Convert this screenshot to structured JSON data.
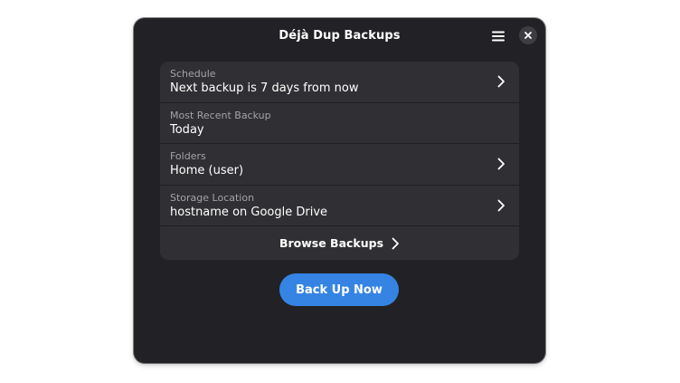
{
  "window": {
    "title": "Déjà Dup Backups",
    "icons": {
      "menu": "hamburger-menu-icon",
      "close": "close-icon",
      "chevron": "chevron-right-icon"
    }
  },
  "rows": [
    {
      "label": "Schedule",
      "value": "Next backup is 7 days from now",
      "has_chevron": true
    },
    {
      "label": "Most Recent Backup",
      "value": "Today",
      "has_chevron": false
    },
    {
      "label": "Folders",
      "value": "Home (user)",
      "has_chevron": true
    },
    {
      "label": "Storage Location",
      "value": "hostname on Google Drive",
      "has_chevron": true
    }
  ],
  "browse": {
    "label": "Browse Backups"
  },
  "primary_button": {
    "label": "Back Up Now"
  },
  "colors": {
    "window_bg": "#222226",
    "card_bg": "#303034",
    "accent": "#3584e4",
    "secondary_text": "#a4a4a8"
  }
}
